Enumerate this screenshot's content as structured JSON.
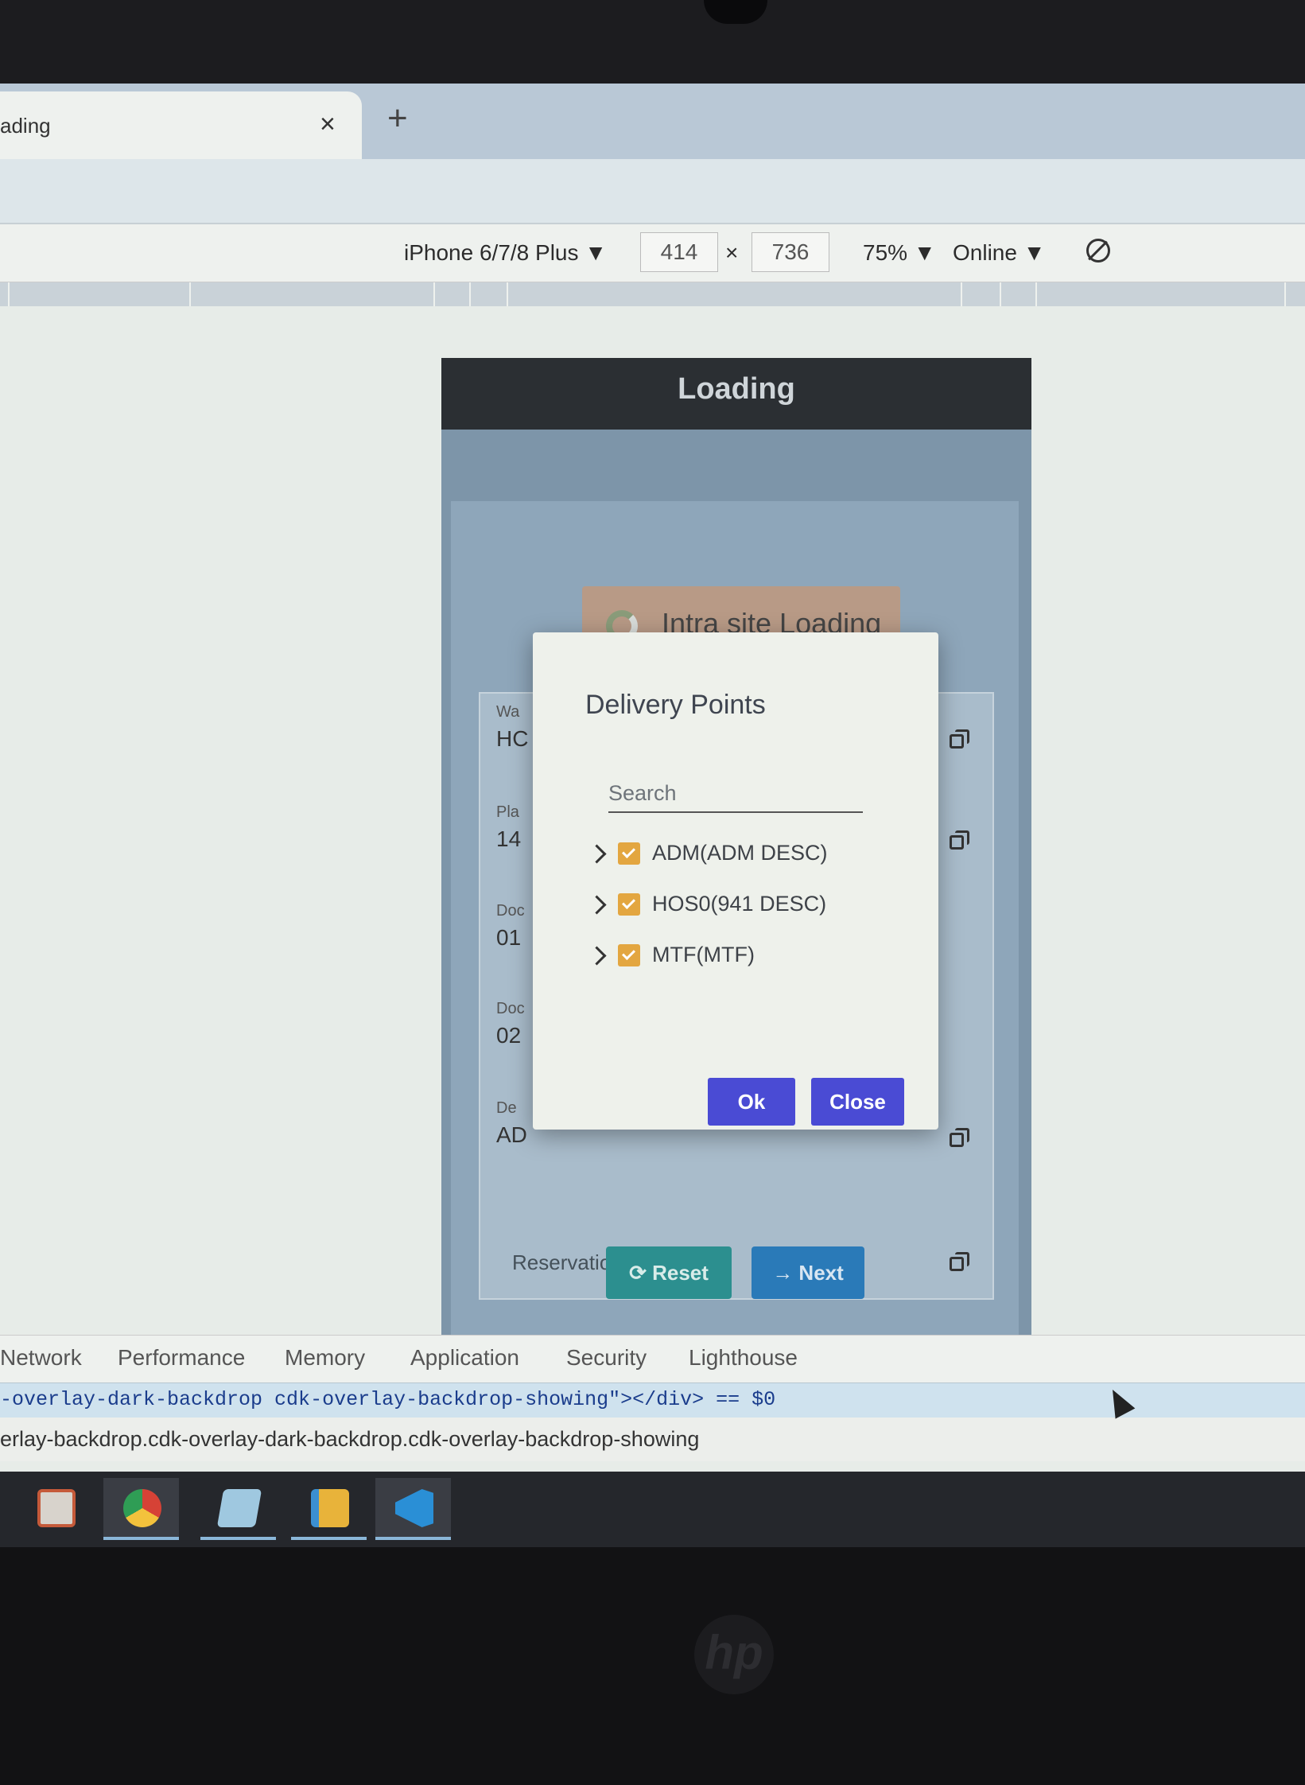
{
  "browser": {
    "tab_title": "ading",
    "close_symbol": "×",
    "new_tab_symbol": "+"
  },
  "device_toolbar": {
    "device": "iPhone 6/7/8 Plus ▼",
    "width": "414",
    "times": "×",
    "height": "736",
    "zoom": "75% ▼",
    "network": "Online ▼"
  },
  "app": {
    "header_title": "Loading",
    "loading_text": "Intra site Loading",
    "fields": [
      {
        "label": "Wa",
        "value": "HC"
      },
      {
        "label": "Pla",
        "value": "14"
      },
      {
        "label": "Doc",
        "value": "01"
      },
      {
        "label": "Doc",
        "value": "02"
      },
      {
        "label": "De",
        "value": "AD"
      }
    ],
    "reservation_label": "Reservation No",
    "reset_label": "⟳ Reset",
    "next_label": "→ Next"
  },
  "dialog": {
    "title": "Delivery Points",
    "search_placeholder": "Search",
    "items": [
      {
        "label": "ADM(ADM DESC)"
      },
      {
        "label": "HOS0(941 DESC)"
      },
      {
        "label": "MTF(MTF)"
      }
    ],
    "ok_label": "Ok",
    "close_label": "Close"
  },
  "devtools": {
    "tabs": [
      "Network",
      "Performance",
      "Memory",
      "Application",
      "Security",
      "Lighthouse"
    ],
    "code_line": "-overlay-dark-backdrop cdk-overlay-backdrop-showing\"></div> == $0",
    "breadcrumb": "erlay-backdrop.cdk-overlay-dark-backdrop.cdk-overlay-backdrop-showing"
  },
  "taskbar": {
    "apps": [
      "slideshow-app-icon",
      "chrome-icon",
      "notes-app-icon",
      "file-explorer-icon",
      "vscode-icon"
    ]
  },
  "hardware": {
    "logo": "hp"
  }
}
